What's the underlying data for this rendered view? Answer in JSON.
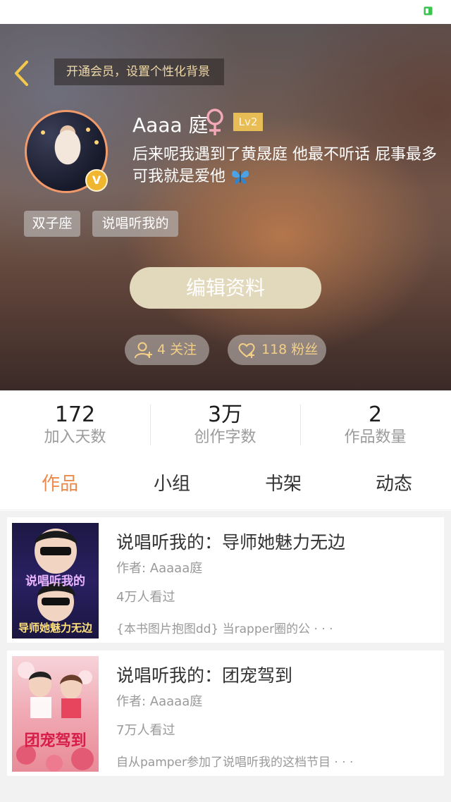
{
  "status_bar": {
    "battery_icon": "battery-icon",
    "battery_color": "#3cc451"
  },
  "header": {
    "back_icon": "chevron-left-icon",
    "vip_banner": "开通会员，设置个性化背景"
  },
  "profile": {
    "username": "Aaaa 庭",
    "gender_icon": "female-icon",
    "level": "Lv2",
    "vip_badge": "V",
    "bio": "后来呢我遇到了黄晟庭 他最不听话 屁事最多 可我就是爱他",
    "bio_emoji": "butterfly-icon",
    "tags": [
      "双子座",
      "说唱听我的"
    ],
    "edit_button": "编辑资料",
    "following": "4 关注",
    "followers": "118 粉丝"
  },
  "stats": [
    {
      "value": "172",
      "label": "加入天数"
    },
    {
      "value": "3万",
      "label": "创作字数"
    },
    {
      "value": "2",
      "label": "作品数量"
    }
  ],
  "tabs": [
    {
      "label": "作品",
      "active": true
    },
    {
      "label": "小组",
      "active": false
    },
    {
      "label": "书架",
      "active": false
    },
    {
      "label": "动态",
      "active": false
    }
  ],
  "books": [
    {
      "title": "说唱听我的：导师她魅力无边",
      "author": "作者: Aaaaa庭",
      "views": "4万人看过",
      "description": "{本书图片抱图dd} 当rapper圈的公 · · ·",
      "cover_text_top": "说唱听我的",
      "cover_text_bottom": "导师她魅力无边"
    },
    {
      "title": "说唱听我的：团宠驾到",
      "author": "作者: Aaaaa庭",
      "views": "7万人看过",
      "description": "自从pamper参加了说唱听我的这档节目 · · ·",
      "cover_text": "团宠驾到"
    }
  ],
  "colors": {
    "accent": "#ec8a4c",
    "gold": "#f0d9a6",
    "level_badge": "#e8bd56",
    "edit_button": "#e2d8bc"
  }
}
